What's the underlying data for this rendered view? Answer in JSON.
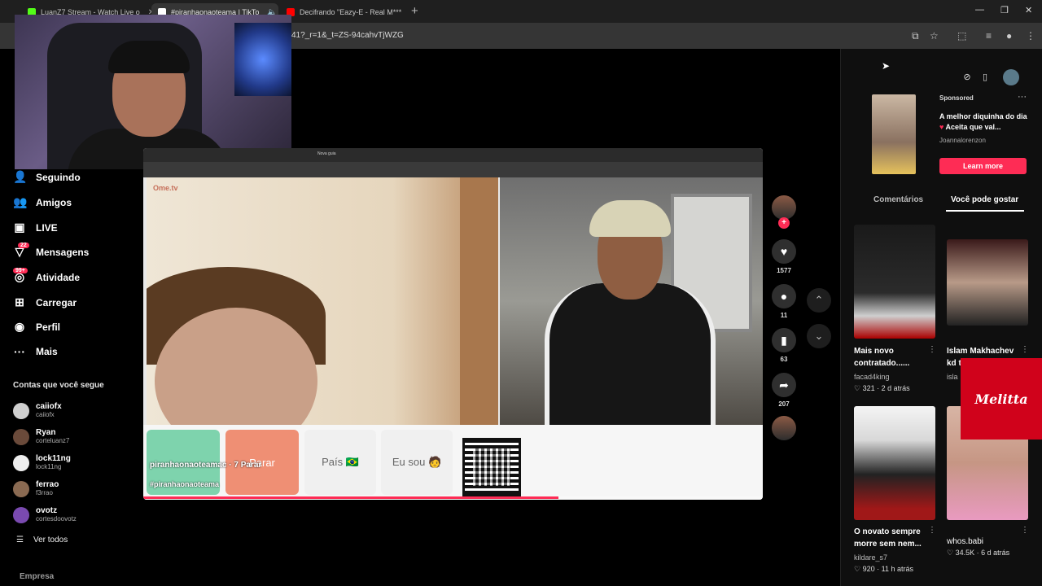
{
  "browser": {
    "tabs": [
      {
        "title": "LuanZ7 Stream - Watch Live o",
        "favicon_color": "#53fc18"
      },
      {
        "title": "#piranhaonaoteama | TikTo",
        "favicon_color": "#ffffff"
      },
      {
        "title": "Decifrando \"Eazy-E - Real M***",
        "favicon_color": "#ff0000"
      }
    ],
    "url": "41?_r=1&_t=ZS-94cahvTjWZG"
  },
  "sidebar": {
    "items": [
      {
        "label": "Seguindo",
        "icon": "people-icon"
      },
      {
        "label": "Amigos",
        "icon": "friends-icon"
      },
      {
        "label": "LIVE",
        "icon": "live-icon"
      },
      {
        "label": "Mensagens",
        "icon": "messages-icon",
        "badge": "22"
      },
      {
        "label": "Atividade",
        "icon": "activity-icon",
        "badge": "99+"
      },
      {
        "label": "Carregar",
        "icon": "upload-icon"
      },
      {
        "label": "Perfil",
        "icon": "profile-icon"
      },
      {
        "label": "Mais",
        "icon": "more-icon"
      }
    ],
    "following_title": "Contas que você segue",
    "accounts": [
      {
        "name": "caiiofx",
        "handle": "caiiofx"
      },
      {
        "name": "Ryan",
        "handle": "corteluanz7"
      },
      {
        "name": "lock11ng",
        "handle": "lock11ng"
      },
      {
        "name": "ferrao",
        "handle": "f3rrao"
      },
      {
        "name": "ovotz",
        "handle": "cortesdoovotz"
      }
    ],
    "see_all": "Ver todos",
    "company": "Empresa"
  },
  "video": {
    "inner_tab": "Nova guia",
    "cam_logo": "Ome.tv",
    "buttons": [
      "Parar",
      "País 🇧🇷",
      "Eu sou 🧑"
    ],
    "author": "piranhaonaoteamac · 7 Parar",
    "hashtag": "#piranhaonaoteama",
    "progress": 0.67
  },
  "actions": {
    "likes": "1577",
    "comments": "11",
    "saves": "63",
    "shares": "207"
  },
  "right": {
    "ad": {
      "sponsored": "Sponsored",
      "title": "A melhor diquinha do dia",
      "title_rest": "Aceita que val...",
      "user": "Joannalorenzon",
      "cta": "Learn more"
    },
    "tabs": [
      "Comentários",
      "Você pode gostar"
    ],
    "cards": [
      {
        "title": "Mais novo contratado......",
        "user": "facad4king",
        "likes": "321",
        "age": "2 d atrás"
      },
      {
        "title": "Islam Makhachev kd t",
        "user": "isla",
        "likes": "",
        "age": ""
      },
      {
        "title": "O novato sempre morre sem nem...",
        "user": "kildare_s7",
        "likes": "920",
        "age": "11 h atrás"
      },
      {
        "title": "whos.babi",
        "user": "",
        "likes": "34.5K",
        "age": "6 d atrás"
      }
    ],
    "sponsor_logo": "Melitta"
  }
}
